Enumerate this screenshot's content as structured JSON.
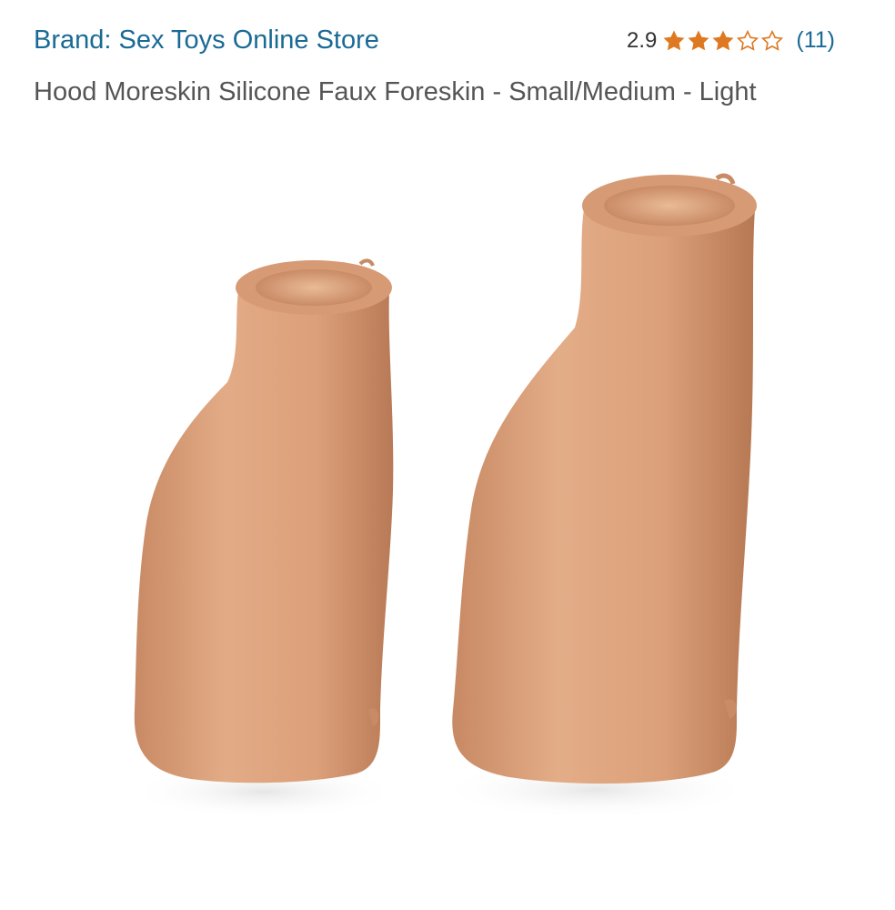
{
  "product": {
    "brand": "Brand: Sex Toys Online Store",
    "rating": {
      "value": "2.9",
      "stars_out_of_5": 2.9,
      "count": "(11)",
      "star_color": "#de7921"
    },
    "title": "Hood Moreskin Silicone Faux Foreskin - Small/Medium - Light",
    "image": {
      "description_icon": "product-photo",
      "skin_color": "#d9a07a",
      "shadow_color": "#b97d59"
    }
  }
}
